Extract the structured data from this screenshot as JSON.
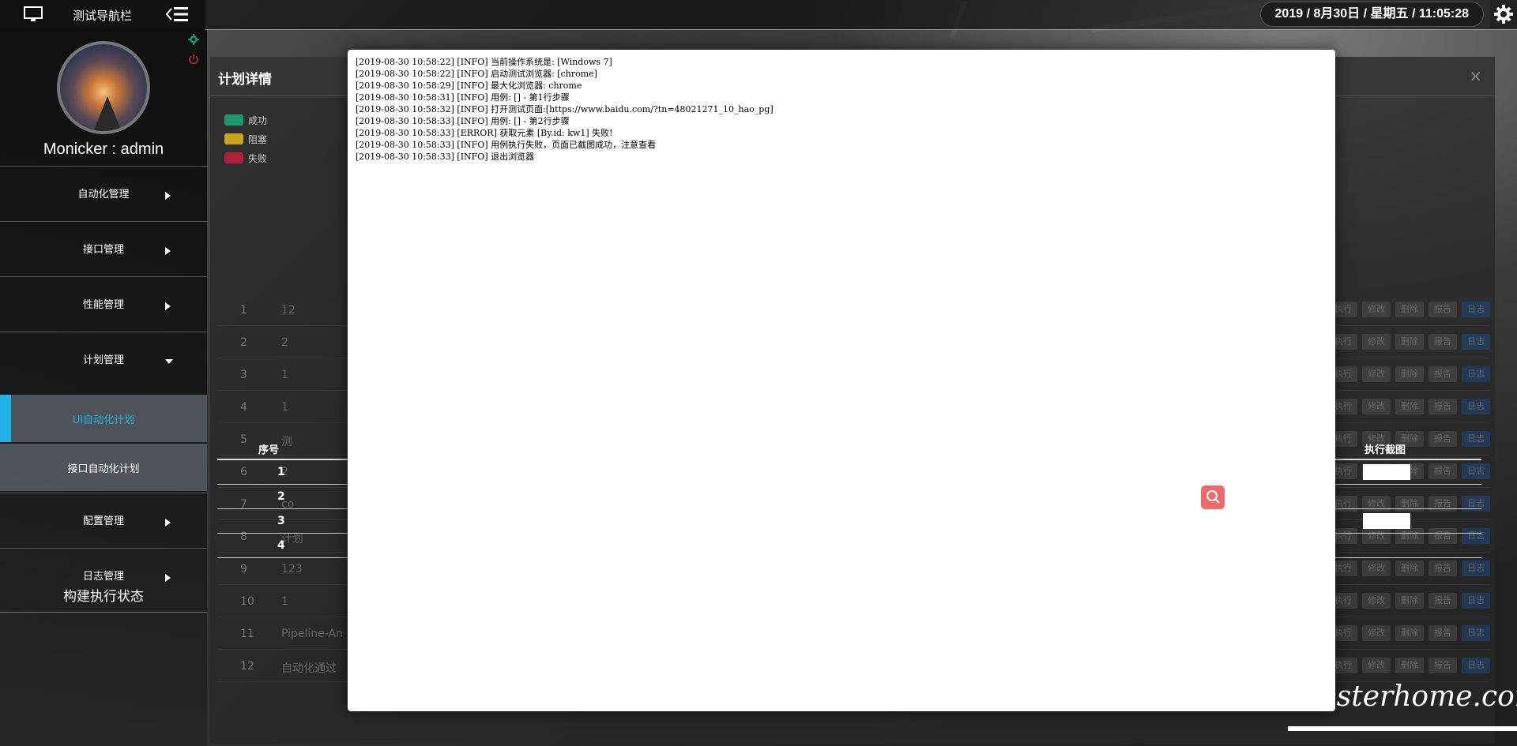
{
  "top": {
    "nav_title": "测试导航栏",
    "datetime": "2019 / 8月30日 / 星期五 / 11:05:28"
  },
  "sidebar": {
    "username": "Monicker : admin",
    "items": [
      {
        "label": "自动化管理"
      },
      {
        "label": "接口管理"
      },
      {
        "label": "性能管理"
      },
      {
        "label": "计划管理"
      },
      {
        "label": "配置管理"
      },
      {
        "label": "日志管理"
      }
    ],
    "subitems": [
      {
        "label": "UI自动化计划"
      },
      {
        "label": "接口自动化计划"
      }
    ],
    "build_status": "构建执行状态"
  },
  "plan": {
    "title": "计划详情",
    "legend": [
      {
        "label": "成功",
        "color": "#1a9a6c"
      },
      {
        "label": "阻塞",
        "color": "#c9a41a"
      },
      {
        "label": "失败",
        "color": "#b0203a"
      }
    ],
    "detail_headers": {
      "index": "序号",
      "screenshot": "执行截图"
    },
    "detail_rows": [
      "1",
      "2",
      "3",
      "4"
    ],
    "close": "×"
  },
  "background_rows": {
    "numbers": [
      "1",
      "2",
      "3",
      "4",
      "5",
      "6",
      "7",
      "8",
      "9",
      "10",
      "11",
      "12"
    ],
    "names": [
      "12",
      "2",
      "1",
      "1",
      "测",
      "2",
      "co",
      "计划",
      "123",
      "1",
      "Pipeline-An",
      "自动化通过"
    ],
    "buttons": [
      "执行",
      "修改",
      "删除",
      "报告",
      "日志"
    ]
  },
  "log": {
    "lines": [
      "[2019-08-30 10:58:22] [INFO] 当前操作系统是: [Windows 7]",
      "[2019-08-30 10:58:22] [INFO] 启动测试浏览器: [chrome]",
      "[2019-08-30 10:58:29] [INFO] 最大化浏览器: chrome",
      "[2019-08-30 10:58:31] [INFO] 用例: [] - 第1行步骤",
      "[2019-08-30 10:58:32] [INFO] 打开测试页面:[https://www.baidu.com/?tn=48021271_10_hao_pg]",
      "[2019-08-30 10:58:33] [INFO] 用例: [] - 第2行步骤",
      "[2019-08-30 10:58:33] [ERROR] 获取元素 [By.id: kw1] 失败!",
      "[2019-08-30 10:58:33] [INFO] 用例执行失败，页面已截图成功，注意查看",
      "[2019-08-30 10:58:33] [INFO] 退出浏览器"
    ]
  },
  "watermark": "testerhome.com"
}
